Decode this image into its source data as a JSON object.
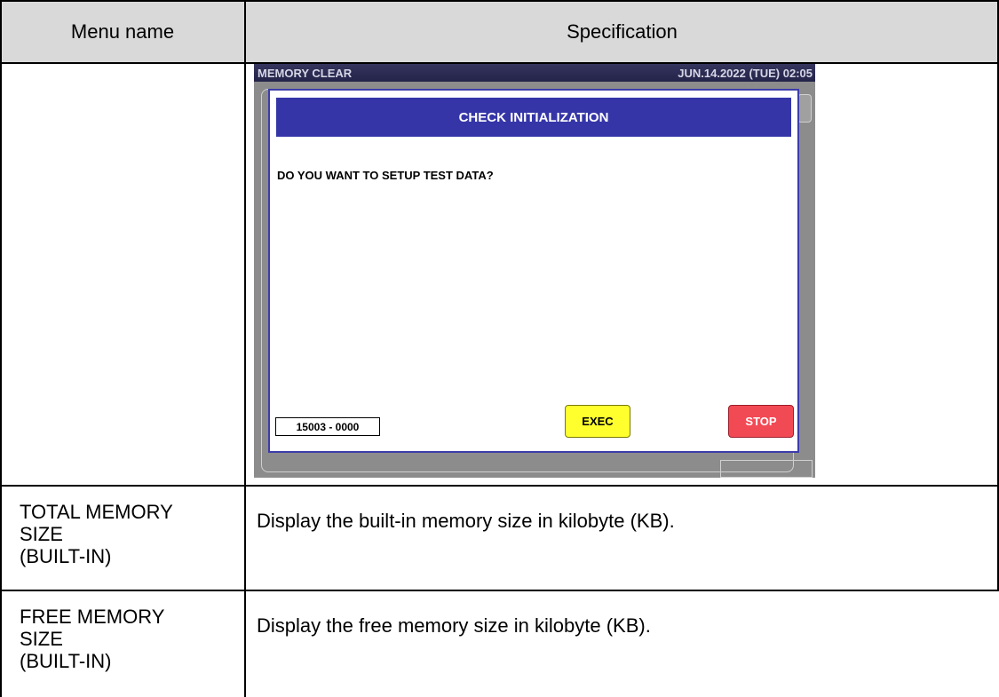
{
  "table": {
    "headers": {
      "menu_name": "Menu name",
      "specification": "Specification"
    },
    "rows": [
      {
        "menu": "",
        "spec": ""
      },
      {
        "menu": "TOTAL MEMORY\nSIZE\n(BUILT-IN)",
        "spec": "Display the built-in memory size in kilobyte (KB)."
      },
      {
        "menu": "FREE MEMORY\nSIZE\n(BUILT-IN)",
        "spec": "Display the free memory size in kilobyte (KB)."
      }
    ]
  },
  "screen": {
    "title": "MEMORY CLEAR",
    "datetime": "JUN.14.2022 (TUE)  02:05",
    "dialog": {
      "title": "CHECK INITIALIZATION",
      "message": "DO YOU WANT TO SETUP TEST DATA?",
      "code": "15003 - 0000",
      "exec_label": "EXEC",
      "stop_label": "STOP"
    },
    "colors": {
      "titlebar": "#24244a",
      "dialog_header": "#3535a8",
      "exec_button": "#ffff2e",
      "stop_button": "#f24a55",
      "screen_background": "#8c8c8c"
    }
  }
}
